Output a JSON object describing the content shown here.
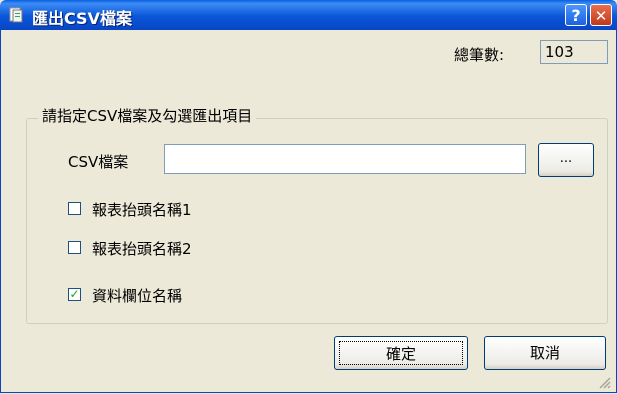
{
  "window": {
    "title": "匯出CSV檔案",
    "help_glyph": "?",
    "close_glyph": "✕"
  },
  "summary": {
    "count_label": "總筆數:",
    "count_value": "103"
  },
  "group": {
    "legend": "請指定CSV檔案及勾選匯出項目",
    "csv_label": "CSV檔案",
    "csv_value": "",
    "browse_label": "..."
  },
  "options": [
    {
      "label": "報表抬頭名稱1",
      "checked": false
    },
    {
      "label": "報表抬頭名稱2",
      "checked": false
    },
    {
      "label": "資料欄位名稱",
      "checked": true
    }
  ],
  "buttons": {
    "ok_label": "確定",
    "cancel_label": "取消"
  },
  "colors": {
    "titlebar": "#0A55D8",
    "dialog_bg": "#ECE9D8",
    "check_mark": "#21A121"
  }
}
